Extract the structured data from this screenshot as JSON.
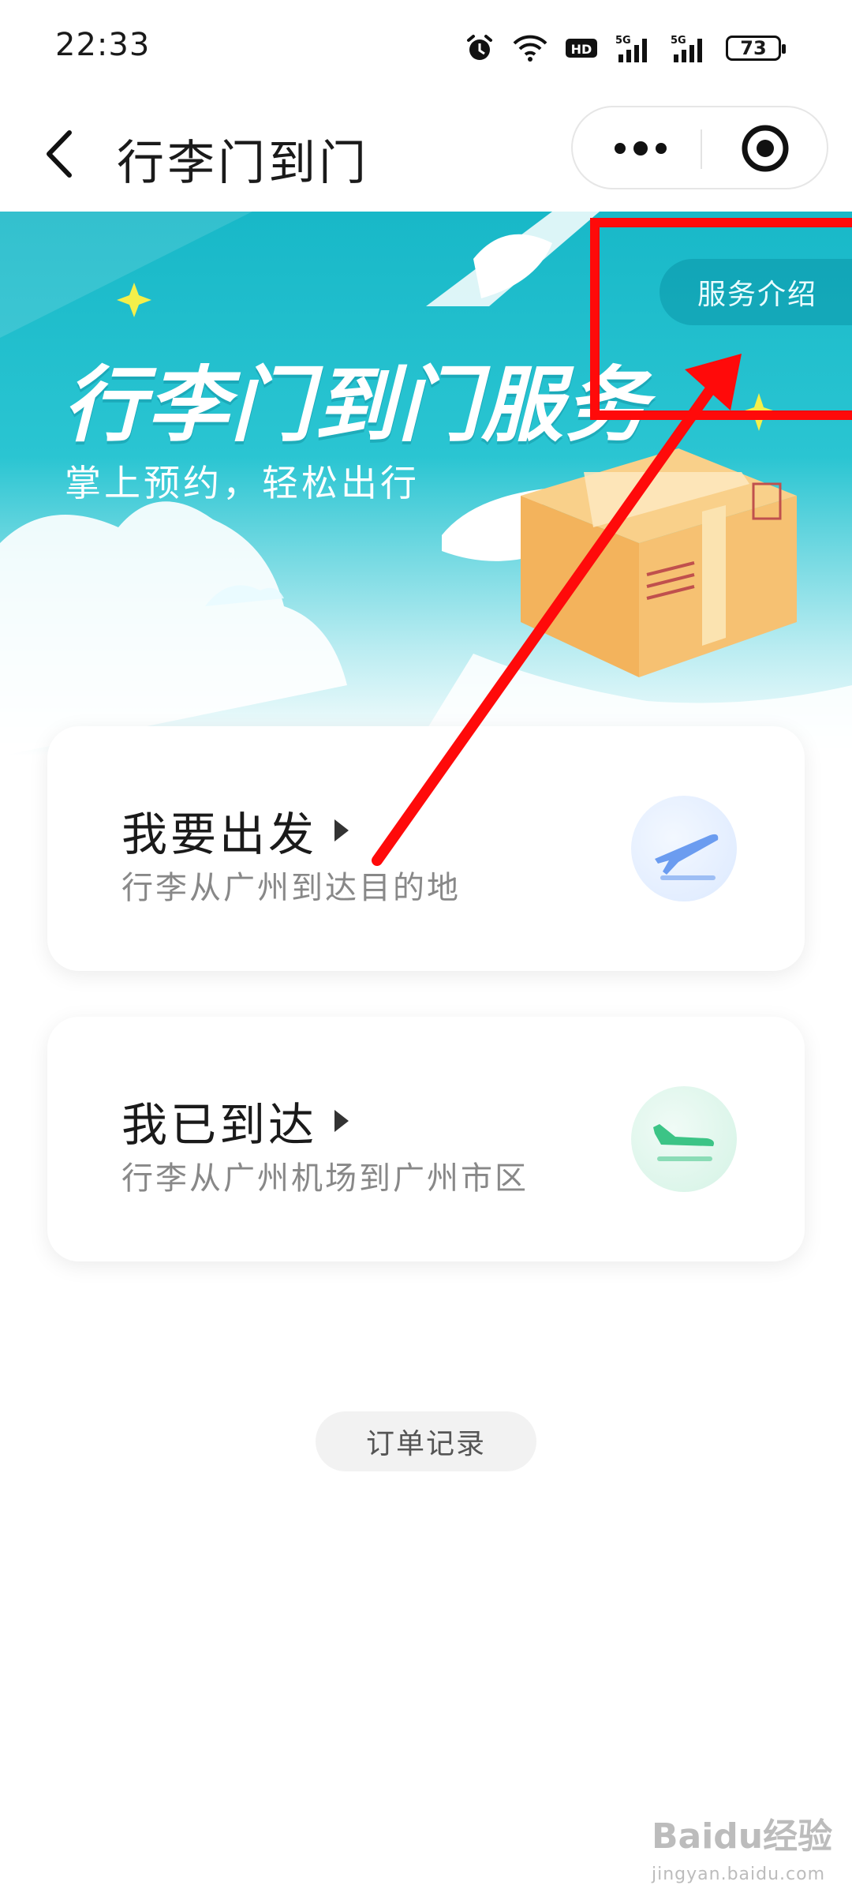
{
  "status_bar": {
    "time": "22:33",
    "battery": "73",
    "icons": [
      "alarm-icon",
      "wifi-icon",
      "hd-icon",
      "signal-5g-icon",
      "signal-5g-icon",
      "battery-icon"
    ]
  },
  "nav": {
    "title": "行李门到门",
    "icons": [
      "back-arrow-icon",
      "more-dots-icon",
      "target-icon"
    ]
  },
  "banner": {
    "title": "行李门到门服务",
    "subtitle": "掌上预约，轻松出行",
    "intro_button": "服务介绍"
  },
  "cards": [
    {
      "title": "我要出发",
      "desc": "行李从广州到达目的地",
      "icon": "plane-takeoff-icon",
      "color": "#6b9cf0"
    },
    {
      "title": "我已到达",
      "desc": "行李从广州机场到广州市区",
      "icon": "plane-landing-icon",
      "color": "#3cc486"
    }
  ],
  "orders_button": "订单记录",
  "annotation_color": "#ff0a0a",
  "watermark": {
    "brand": "Baidu经验",
    "url": "jingyan.baidu.com"
  }
}
